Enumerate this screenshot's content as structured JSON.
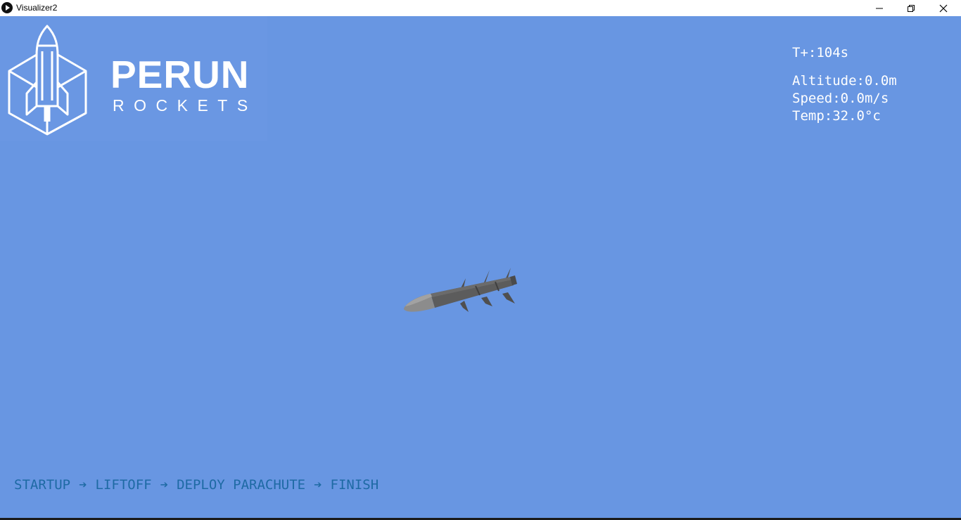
{
  "window": {
    "title": "Visualizer2",
    "controls": [
      "minimize",
      "restore",
      "close"
    ]
  },
  "logo": {
    "name": "PERUN",
    "subtitle": "ROCKETS"
  },
  "telemetry": {
    "time": "T+:104s",
    "altitude": "Altitude:0.0m",
    "speed": "Speed:0.0m/s",
    "temp": "Temp:32.0°c"
  },
  "stages": {
    "items": [
      "STARTUP",
      "LIFTOFF",
      "DEPLOY PARACHUTE",
      "FINISH"
    ],
    "separator": "➔"
  },
  "colors": {
    "background": "#6896e2",
    "stage_text": "#1e6aa4",
    "telemetry_text": "#ffffff"
  }
}
